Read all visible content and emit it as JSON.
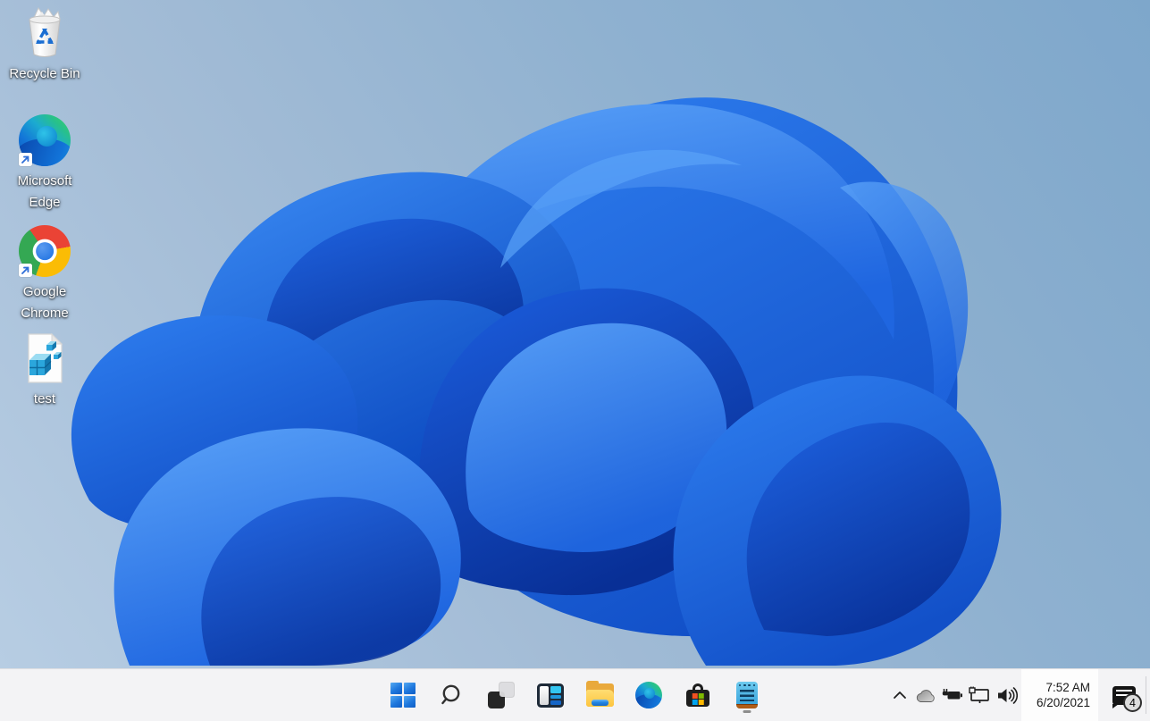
{
  "wallpaper": {
    "name": "windows-11-bloom",
    "bg_top_right": "#7ea7cb",
    "bg_bottom_left": "#b7cde3",
    "bloom_primary_blue": "#1560e0",
    "bloom_dark_blue": "#0a3fae",
    "bloom_light_blue": "#5aa2f8"
  },
  "desktop": {
    "icons": [
      {
        "id": "recycle-bin",
        "label": "Recycle Bin"
      },
      {
        "id": "microsoft-edge",
        "label": "Microsoft Edge"
      },
      {
        "id": "google-chrome",
        "label": "Google Chrome"
      },
      {
        "id": "test-registry-file",
        "label": "test"
      }
    ]
  },
  "taskbar": {
    "buttons": [
      {
        "id": "start"
      },
      {
        "id": "search"
      },
      {
        "id": "task-view"
      },
      {
        "id": "widgets"
      },
      {
        "id": "file-explorer"
      },
      {
        "id": "microsoft-edge"
      },
      {
        "id": "microsoft-store"
      },
      {
        "id": "notepad",
        "running": true
      }
    ],
    "tray": {
      "icons": [
        {
          "id": "hidden-icons-chevron"
        },
        {
          "id": "onedrive-cloud"
        },
        {
          "id": "battery-charging"
        },
        {
          "id": "network-ethernet"
        },
        {
          "id": "volume"
        }
      ],
      "clock": {
        "time": "7:52 AM",
        "date": "6/20/2021"
      },
      "notification_count": "4"
    }
  }
}
